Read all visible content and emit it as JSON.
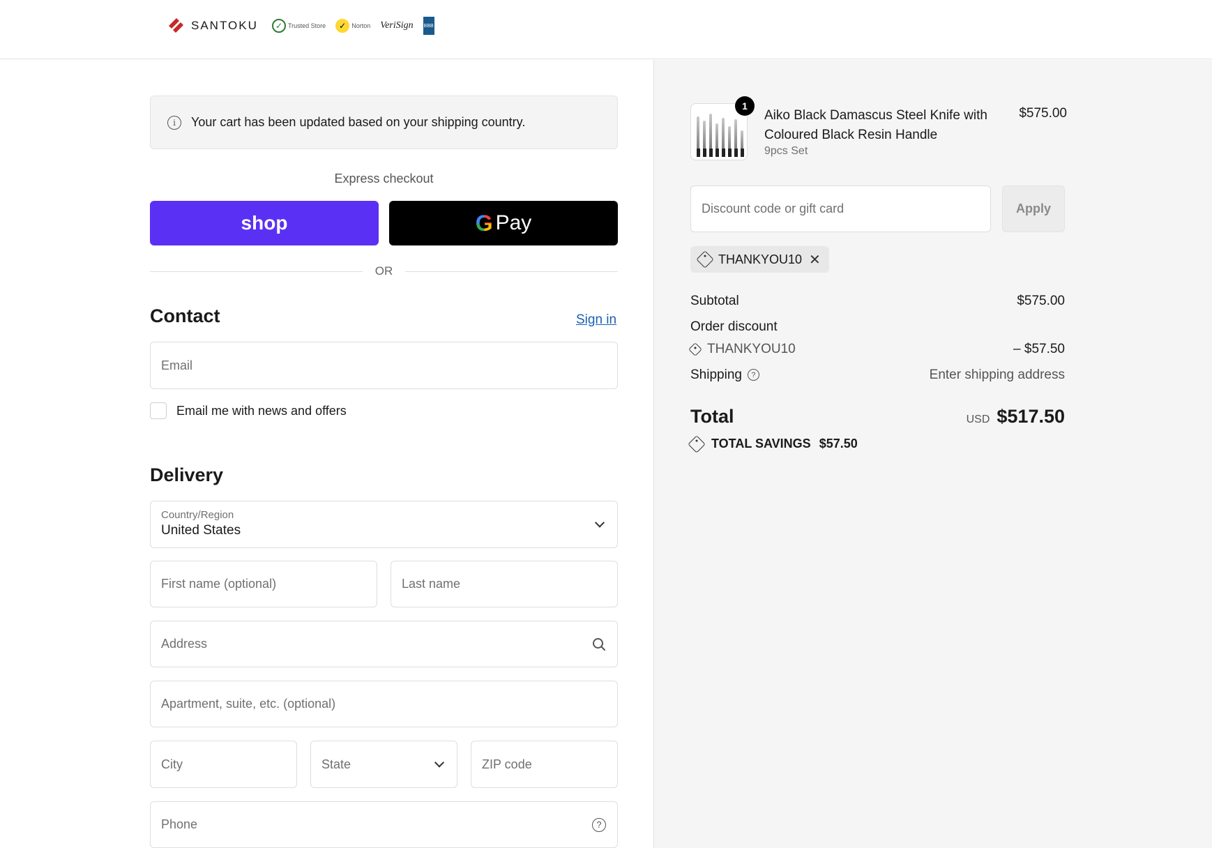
{
  "header": {
    "logo_text": "SANTOKU",
    "badges": {
      "trusted": "Trusted Store",
      "norton": "Norton",
      "verisign": "VeriSign",
      "bbb": "BBB"
    }
  },
  "notice": {
    "text": "Your cart has been updated based on your shipping country."
  },
  "express": {
    "label": "Express checkout",
    "shop_label": "shop",
    "gpay_label": "Pay",
    "or_label": "OR"
  },
  "contact": {
    "title": "Contact",
    "sign_in": "Sign in",
    "email_placeholder": "Email",
    "newsletter_label": "Email me with news and offers"
  },
  "delivery": {
    "title": "Delivery",
    "country_label": "Country/Region",
    "country_value": "United States",
    "first_name_placeholder": "First name (optional)",
    "last_name_placeholder": "Last name",
    "address_placeholder": "Address",
    "apartment_placeholder": "Apartment, suite, etc. (optional)",
    "city_placeholder": "City",
    "state_placeholder": "State",
    "zip_placeholder": "ZIP code",
    "phone_placeholder": "Phone"
  },
  "order": {
    "product": {
      "quantity": "1",
      "name": "Aiko Black Damascus Steel Knife with Coloured Black Resin Handle",
      "variant": "9pcs Set",
      "price": "$575.00"
    },
    "discount_placeholder": "Discount code or gift card",
    "apply_label": "Apply",
    "applied_code": "THANKYOU10",
    "subtotal_label": "Subtotal",
    "subtotal_value": "$575.00",
    "order_discount_label": "Order discount",
    "discount_code": "THANKYOU10",
    "discount_value": "– $57.50",
    "shipping_label": "Shipping",
    "shipping_value": "Enter shipping address",
    "total_label": "Total",
    "total_currency": "USD",
    "total_value": "$517.50",
    "savings_label": "TOTAL SAVINGS",
    "savings_value": "$57.50"
  },
  "colors": {
    "shop_button": "#5a31f4",
    "gpay_button": "#000000",
    "link": "#1a5fb4",
    "summary_bg": "#f5f5f5"
  }
}
